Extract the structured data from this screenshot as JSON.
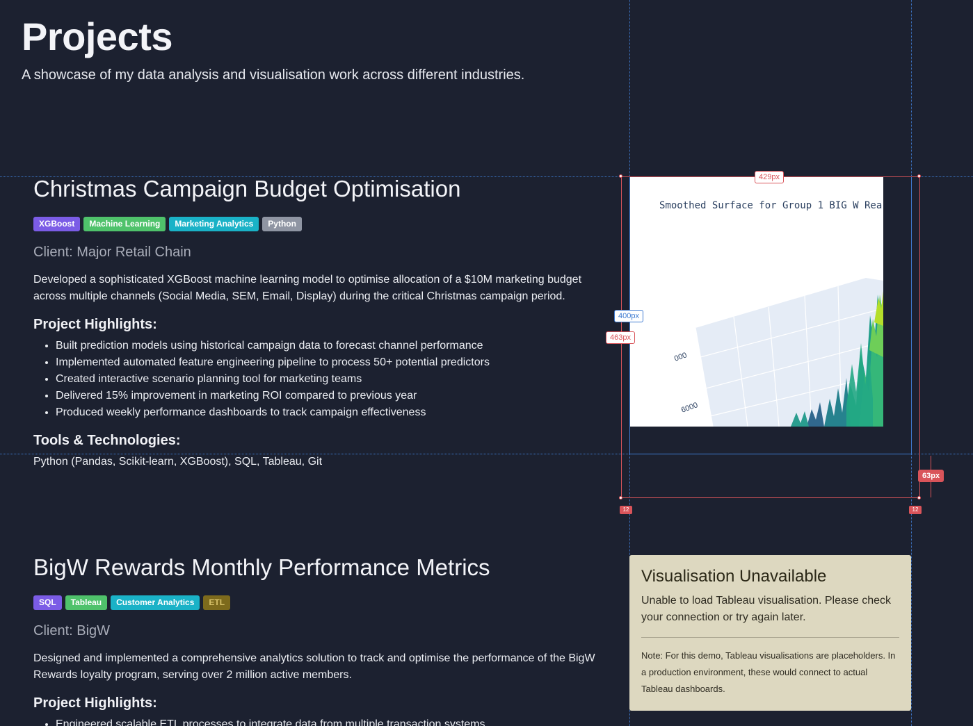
{
  "page": {
    "title": "Projects",
    "subtitle": "A showcase of my data analysis and visualisation work across different industries."
  },
  "projects": [
    {
      "title": "Christmas Campaign Budget Optimisation",
      "tags": [
        {
          "label": "XGBoost",
          "color": "#7b5ce6"
        },
        {
          "label": "Machine Learning",
          "color": "#4fc26b"
        },
        {
          "label": "Marketing Analytics",
          "color": "#1ab2c7"
        },
        {
          "label": "Python",
          "color": "#8f95a3"
        }
      ],
      "client": "Client: Major Retail Chain",
      "description": "Developed a sophisticated XGBoost machine learning model to optimise allocation of a $10M marketing budget across multiple channels (Social Media, SEM, Email, Display) during the critical Christmas campaign period.",
      "highlights_heading": "Project Highlights:",
      "highlights": [
        "Built prediction models using historical campaign data to forecast channel performance",
        "Implemented automated feature engineering pipeline to process 50+ potential predictors",
        "Created interactive scenario planning tool for marketing teams",
        "Delivered 15% improvement in marketing ROI compared to previous year",
        "Produced weekly performance dashboards to track campaign effectiveness"
      ],
      "tools_heading": "Tools & Technologies:",
      "tools": "Python (Pandas, Scikit-learn, XGBoost), SQL, Tableau, Git",
      "visual": {
        "title": "Smoothed Surface for Group 1 BIG W Rea",
        "axis_labels": [
          "000",
          "6000"
        ]
      }
    },
    {
      "title": "BigW Rewards Monthly Performance Metrics",
      "tags": [
        {
          "label": "SQL",
          "color": "#7b5ce6"
        },
        {
          "label": "Tableau",
          "color": "#4fc26b"
        },
        {
          "label": "Customer Analytics",
          "color": "#1ab2c7"
        },
        {
          "label": "ETL",
          "color": "#7d6a1c",
          "text_color": "#d9c36a"
        }
      ],
      "client": "Client: BigW",
      "description": "Designed and implemented a comprehensive analytics solution to track and optimise the performance of the BigW Rewards loyalty program, serving over 2 million active members.",
      "highlights_heading": "Project Highlights:",
      "highlights": [
        "Engineered scalable ETL processes to integrate data from multiple transaction systems"
      ],
      "unavailable": {
        "heading": "Visualisation Unavailable",
        "message": "Unable to load Tableau visualisation. Please check your connection or try again later.",
        "note": "Note: For this demo, Tableau visualisations are placeholders. In a production environment, these would connect to actual Tableau dashboards."
      }
    }
  ],
  "devtools": {
    "width_label": "429px",
    "inner_height_label": "400px",
    "outer_height_label": "463px",
    "margin_label": "63px",
    "corner_left": "12",
    "corner_right": "12"
  }
}
